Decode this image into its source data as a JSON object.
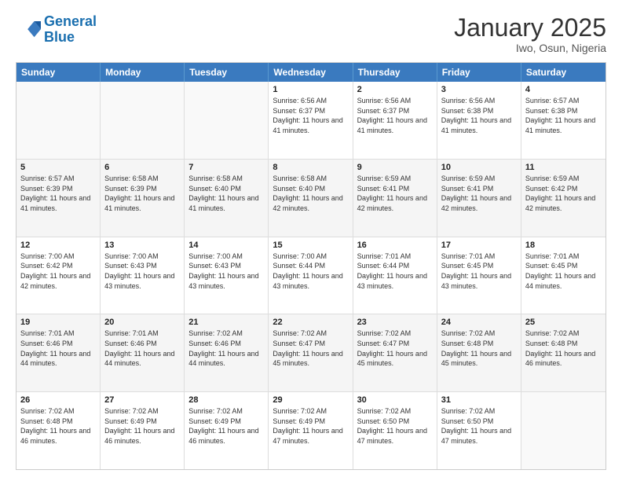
{
  "logo": {
    "line1": "General",
    "line2": "Blue"
  },
  "title": "January 2025",
  "location": "Iwo, Osun, Nigeria",
  "header_days": [
    "Sunday",
    "Monday",
    "Tuesday",
    "Wednesday",
    "Thursday",
    "Friday",
    "Saturday"
  ],
  "weeks": [
    [
      {
        "day": "",
        "info": ""
      },
      {
        "day": "",
        "info": ""
      },
      {
        "day": "",
        "info": ""
      },
      {
        "day": "1",
        "info": "Sunrise: 6:56 AM\nSunset: 6:37 PM\nDaylight: 11 hours and 41 minutes."
      },
      {
        "day": "2",
        "info": "Sunrise: 6:56 AM\nSunset: 6:37 PM\nDaylight: 11 hours and 41 minutes."
      },
      {
        "day": "3",
        "info": "Sunrise: 6:56 AM\nSunset: 6:38 PM\nDaylight: 11 hours and 41 minutes."
      },
      {
        "day": "4",
        "info": "Sunrise: 6:57 AM\nSunset: 6:38 PM\nDaylight: 11 hours and 41 minutes."
      }
    ],
    [
      {
        "day": "5",
        "info": "Sunrise: 6:57 AM\nSunset: 6:39 PM\nDaylight: 11 hours and 41 minutes."
      },
      {
        "day": "6",
        "info": "Sunrise: 6:58 AM\nSunset: 6:39 PM\nDaylight: 11 hours and 41 minutes."
      },
      {
        "day": "7",
        "info": "Sunrise: 6:58 AM\nSunset: 6:40 PM\nDaylight: 11 hours and 41 minutes."
      },
      {
        "day": "8",
        "info": "Sunrise: 6:58 AM\nSunset: 6:40 PM\nDaylight: 11 hours and 42 minutes."
      },
      {
        "day": "9",
        "info": "Sunrise: 6:59 AM\nSunset: 6:41 PM\nDaylight: 11 hours and 42 minutes."
      },
      {
        "day": "10",
        "info": "Sunrise: 6:59 AM\nSunset: 6:41 PM\nDaylight: 11 hours and 42 minutes."
      },
      {
        "day": "11",
        "info": "Sunrise: 6:59 AM\nSunset: 6:42 PM\nDaylight: 11 hours and 42 minutes."
      }
    ],
    [
      {
        "day": "12",
        "info": "Sunrise: 7:00 AM\nSunset: 6:42 PM\nDaylight: 11 hours and 42 minutes."
      },
      {
        "day": "13",
        "info": "Sunrise: 7:00 AM\nSunset: 6:43 PM\nDaylight: 11 hours and 43 minutes."
      },
      {
        "day": "14",
        "info": "Sunrise: 7:00 AM\nSunset: 6:43 PM\nDaylight: 11 hours and 43 minutes."
      },
      {
        "day": "15",
        "info": "Sunrise: 7:00 AM\nSunset: 6:44 PM\nDaylight: 11 hours and 43 minutes."
      },
      {
        "day": "16",
        "info": "Sunrise: 7:01 AM\nSunset: 6:44 PM\nDaylight: 11 hours and 43 minutes."
      },
      {
        "day": "17",
        "info": "Sunrise: 7:01 AM\nSunset: 6:45 PM\nDaylight: 11 hours and 43 minutes."
      },
      {
        "day": "18",
        "info": "Sunrise: 7:01 AM\nSunset: 6:45 PM\nDaylight: 11 hours and 44 minutes."
      }
    ],
    [
      {
        "day": "19",
        "info": "Sunrise: 7:01 AM\nSunset: 6:46 PM\nDaylight: 11 hours and 44 minutes."
      },
      {
        "day": "20",
        "info": "Sunrise: 7:01 AM\nSunset: 6:46 PM\nDaylight: 11 hours and 44 minutes."
      },
      {
        "day": "21",
        "info": "Sunrise: 7:02 AM\nSunset: 6:46 PM\nDaylight: 11 hours and 44 minutes."
      },
      {
        "day": "22",
        "info": "Sunrise: 7:02 AM\nSunset: 6:47 PM\nDaylight: 11 hours and 45 minutes."
      },
      {
        "day": "23",
        "info": "Sunrise: 7:02 AM\nSunset: 6:47 PM\nDaylight: 11 hours and 45 minutes."
      },
      {
        "day": "24",
        "info": "Sunrise: 7:02 AM\nSunset: 6:48 PM\nDaylight: 11 hours and 45 minutes."
      },
      {
        "day": "25",
        "info": "Sunrise: 7:02 AM\nSunset: 6:48 PM\nDaylight: 11 hours and 46 minutes."
      }
    ],
    [
      {
        "day": "26",
        "info": "Sunrise: 7:02 AM\nSunset: 6:48 PM\nDaylight: 11 hours and 46 minutes."
      },
      {
        "day": "27",
        "info": "Sunrise: 7:02 AM\nSunset: 6:49 PM\nDaylight: 11 hours and 46 minutes."
      },
      {
        "day": "28",
        "info": "Sunrise: 7:02 AM\nSunset: 6:49 PM\nDaylight: 11 hours and 46 minutes."
      },
      {
        "day": "29",
        "info": "Sunrise: 7:02 AM\nSunset: 6:49 PM\nDaylight: 11 hours and 47 minutes."
      },
      {
        "day": "30",
        "info": "Sunrise: 7:02 AM\nSunset: 6:50 PM\nDaylight: 11 hours and 47 minutes."
      },
      {
        "day": "31",
        "info": "Sunrise: 7:02 AM\nSunset: 6:50 PM\nDaylight: 11 hours and 47 minutes."
      },
      {
        "day": "",
        "info": ""
      }
    ]
  ]
}
